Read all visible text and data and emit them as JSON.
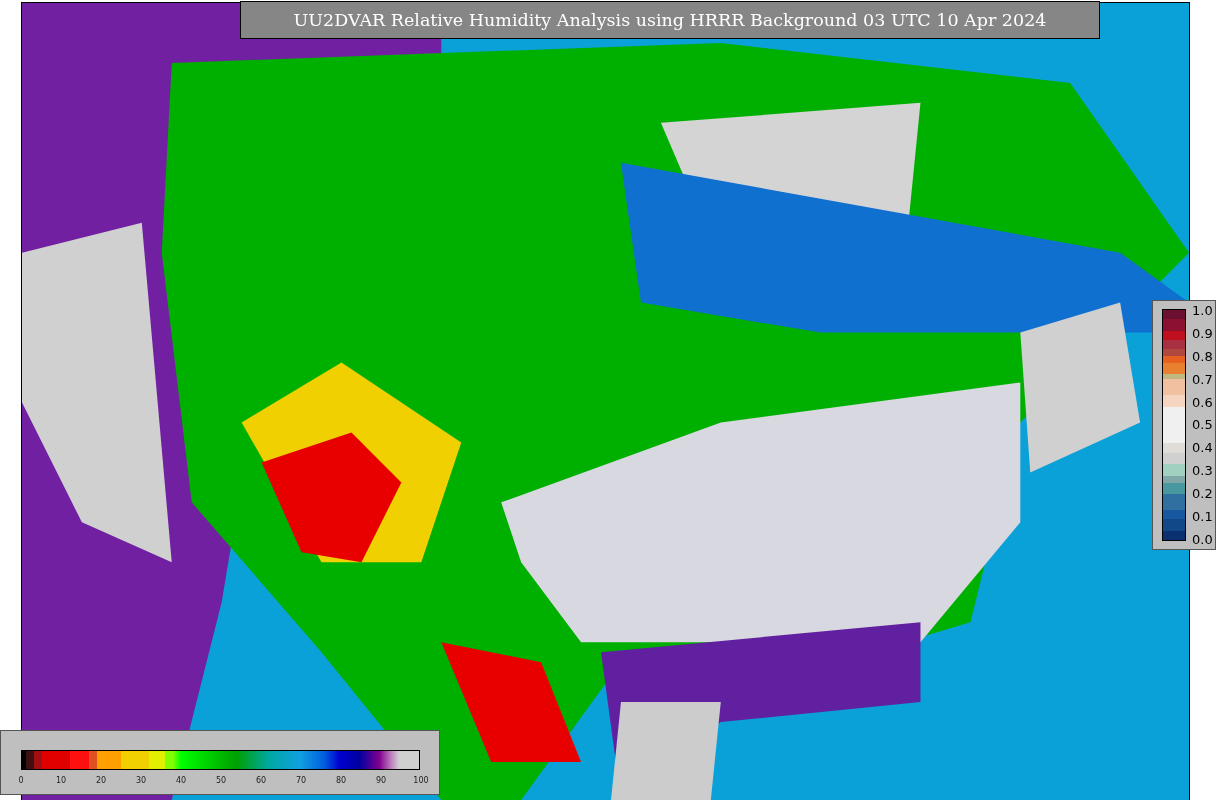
{
  "title": "UU2DVAR Relative Humidity Analysis using HRRR Background 03 UTC 10 Apr 2024",
  "observation_colorbar": {
    "ticks": [
      "1.0",
      "0.9",
      "0.8",
      "0.7",
      "0.6",
      "0.5",
      "0.4",
      "0.3",
      "0.2",
      "0.1",
      "0.0"
    ]
  },
  "analysis_colorbar": {
    "ticks": [
      "0",
      "10",
      "20",
      "30",
      "40",
      "50",
      "60",
      "70",
      "80",
      "90",
      "100"
    ]
  }
}
